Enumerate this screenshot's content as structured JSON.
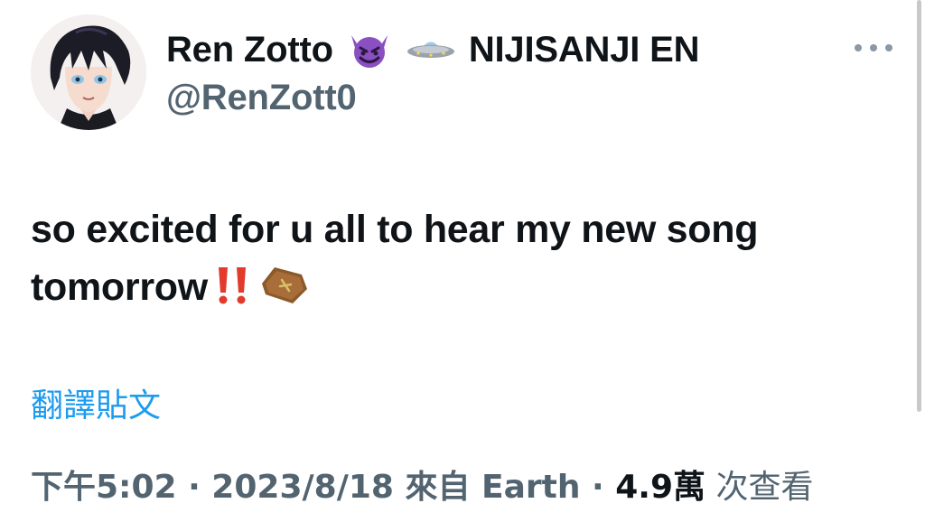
{
  "author": {
    "display_name": "Ren Zotto",
    "badge_emoji_1": "smiling-devil-emoji",
    "badge_emoji_2": "ufo-emoji",
    "affiliation": "NIJISANJI EN",
    "handle": "@RenZott0",
    "avatar": "avatar-icon"
  },
  "tweet": {
    "text": "so excited for u all to hear my new song tomorrow",
    "trailing_emojis": [
      "double-exclamation-emoji",
      "coffin-emoji"
    ],
    "translate_label": "翻譯貼文"
  },
  "meta": {
    "time": "下午5:02",
    "sep": " · ",
    "date": "2023/8/18",
    "source": " 來自 Earth",
    "views_count": "4.9萬",
    "views_label": " 次查看"
  },
  "colors": {
    "text": "#0f1419",
    "secondary": "#536471",
    "link": "#1d9bf0"
  }
}
